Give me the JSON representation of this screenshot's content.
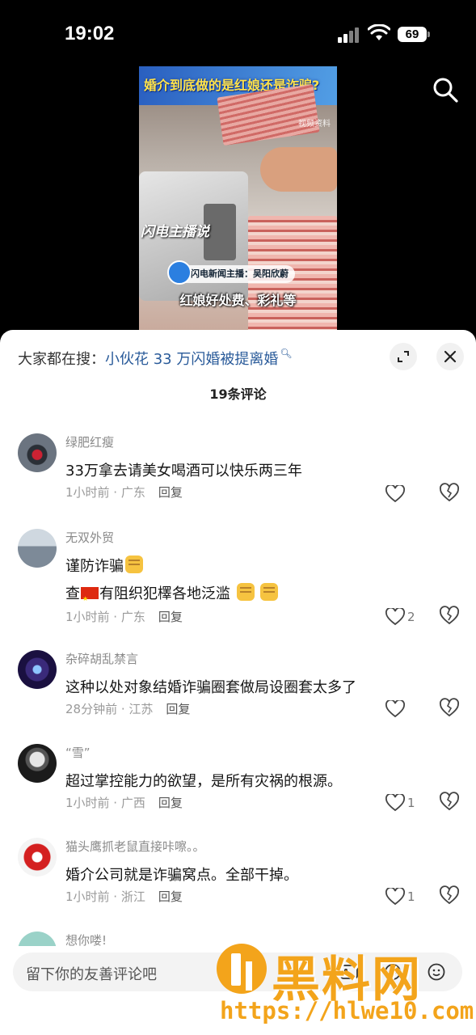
{
  "status_bar": {
    "time": "19:02",
    "battery": "69"
  },
  "video": {
    "headline": "婚介到底做的是红娘还是诈骗?",
    "source_tag": "视频资料",
    "logo_text": "闪电主播说",
    "anchor_label": "闪电新闻主播：吴阳欣蔚",
    "caption": "红娘好处费、彩礼等"
  },
  "sheet": {
    "hot_search_prefix": "大家都在搜：",
    "hot_search_term": "小伙花 33 万闪婚被提离婚",
    "comment_count": "19条评论"
  },
  "comments": [
    {
      "name": "绿肥红瘦",
      "lines": [
        "33万拿去请美女喝酒可以快乐两三年"
      ],
      "time_loc": "1小时前 · 广东",
      "reply": "回复",
      "likes": ""
    },
    {
      "name": "无双外贸",
      "lines": [
        "谨防诈骗",
        "查",
        "有阻织犯檡各地泛滥"
      ],
      "time_loc": "1小时前 · 广东",
      "reply": "回复",
      "likes": "2"
    },
    {
      "name": "杂碎胡乱禁言",
      "lines": [
        "这种以处对象结婚诈骗圈套做局设圈套太多了"
      ],
      "time_loc": "28分钟前 · 江苏",
      "reply": "回复",
      "likes": ""
    },
    {
      "name": "“雪”",
      "lines": [
        "超过掌控能力的欲望，是所有灾祸的根源。"
      ],
      "time_loc": "1小时前 · 广西",
      "reply": "回复",
      "likes": "1"
    },
    {
      "name": "猫头鹰抓老鼠直接咔嚓。。",
      "lines": [
        "婚介公司就是诈骗窝点。全部干掉。"
      ],
      "time_loc": "1小时前 · 浙江",
      "reply": "回复",
      "likes": "1"
    },
    {
      "name": "想你喽!",
      "lines": [],
      "time_loc": "",
      "reply": "",
      "likes": ""
    }
  ],
  "input": {
    "placeholder": "留下你的友善评论吧"
  },
  "watermark": {
    "title": "黑料网",
    "url": "https://hlwe10.com"
  },
  "colors": {
    "accent_link": "#2a5b9a",
    "watermark": "#f3a41b"
  }
}
